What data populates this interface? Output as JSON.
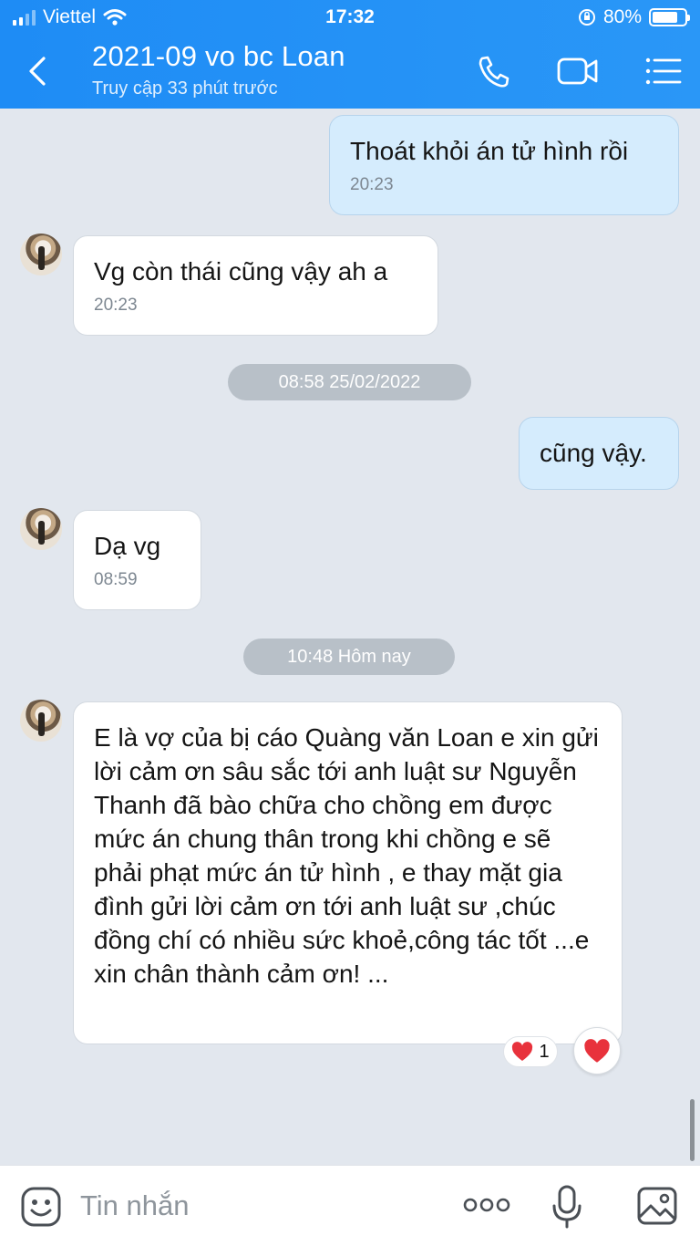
{
  "status_bar": {
    "carrier": "Viettel",
    "time": "17:32",
    "battery": "80%",
    "battery_level": 0.8
  },
  "header": {
    "title": "2021-09 vo bc Loan",
    "subtitle": "Truy cập 33 phút trước"
  },
  "messages": [
    {
      "direction": "out",
      "text": "Thoát khỏi án tử hình rồi",
      "time": "20:23"
    },
    {
      "direction": "in",
      "text": "Vg còn thái cũng vậy ah a",
      "time": "20:23"
    },
    {
      "direction": "out",
      "text": "cũng vậy."
    },
    {
      "direction": "in",
      "text": "Dạ vg",
      "time": "08:59"
    },
    {
      "direction": "in",
      "text": "E là vợ của bị cáo Quàng văn Loan e xin gửi lời cảm ơn sâu sắc tới anh luật sư Nguyễn Thanh đã bào chữa cho chồng em được mức án chung thân trong khi chồng e sẽ phải phạt mức án tử hình , e thay mặt gia đình gửi lời cảm ơn tới anh luật sư ,chúc đồng chí có nhiều sức khoẻ,công tác tốt ...e xin chân thành cảm ơn! ..."
    }
  ],
  "separators": [
    "08:58 25/02/2022",
    "10:48 Hôm nay"
  ],
  "reactions": {
    "count": "1"
  },
  "input": {
    "placeholder": "Tin nhắn",
    "more_label": "ooo"
  },
  "colors": {
    "header": "#1e8cf5",
    "outgoing_bubble": "#d5ecfd",
    "incoming_bubble": "#ffffff",
    "background": "#e2e7ee",
    "heart": "#e8323c"
  }
}
